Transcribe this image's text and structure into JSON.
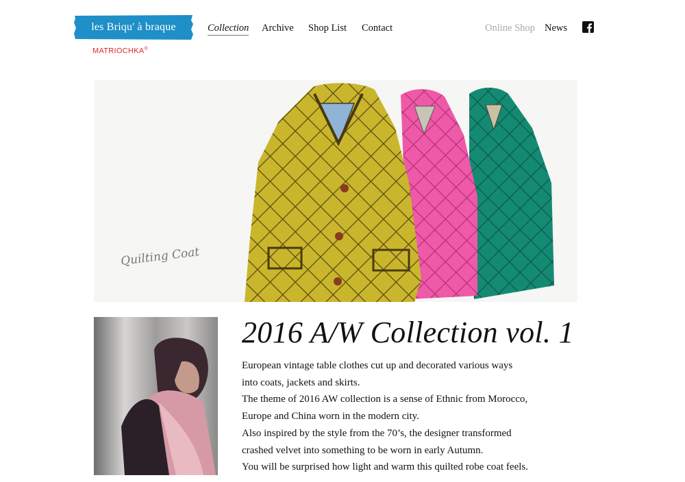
{
  "header": {
    "logo_text": "les Briqu' à braque",
    "sub_brand": "MATRIOCHKA",
    "sub_brand_mark": "®",
    "brand_color": "#1e8fc7",
    "sub_brand_color": "#d9262b",
    "nav_left": [
      "Collection",
      "Archive",
      "Shop List",
      "Contact"
    ],
    "active_nav": "Collection",
    "nav_right": {
      "online_shop": "Online Shop",
      "news": "News",
      "social_icon": "facebook-icon"
    }
  },
  "hero": {
    "caption": "Quilting Coat",
    "coat_colors": [
      "#c7b52a",
      "#ec5aa4",
      "#1b8d76"
    ]
  },
  "collection": {
    "title": "2016 A/W Collection vol. 1",
    "lines": [
      "European vintage table clothes cut up and decorated various ways",
      "into coats, jackets and skirts.",
      "The theme of 2016 AW collection is a sense of Ethnic from Morocco,",
      "Europe and China worn in the modern city.",
      "Also inspired by the style from the 70’s, the designer transformed",
      "crashed velvet into something to be worn in early Autumn.",
      "You will be surprised how light and warm this quilted robe coat feels."
    ]
  }
}
